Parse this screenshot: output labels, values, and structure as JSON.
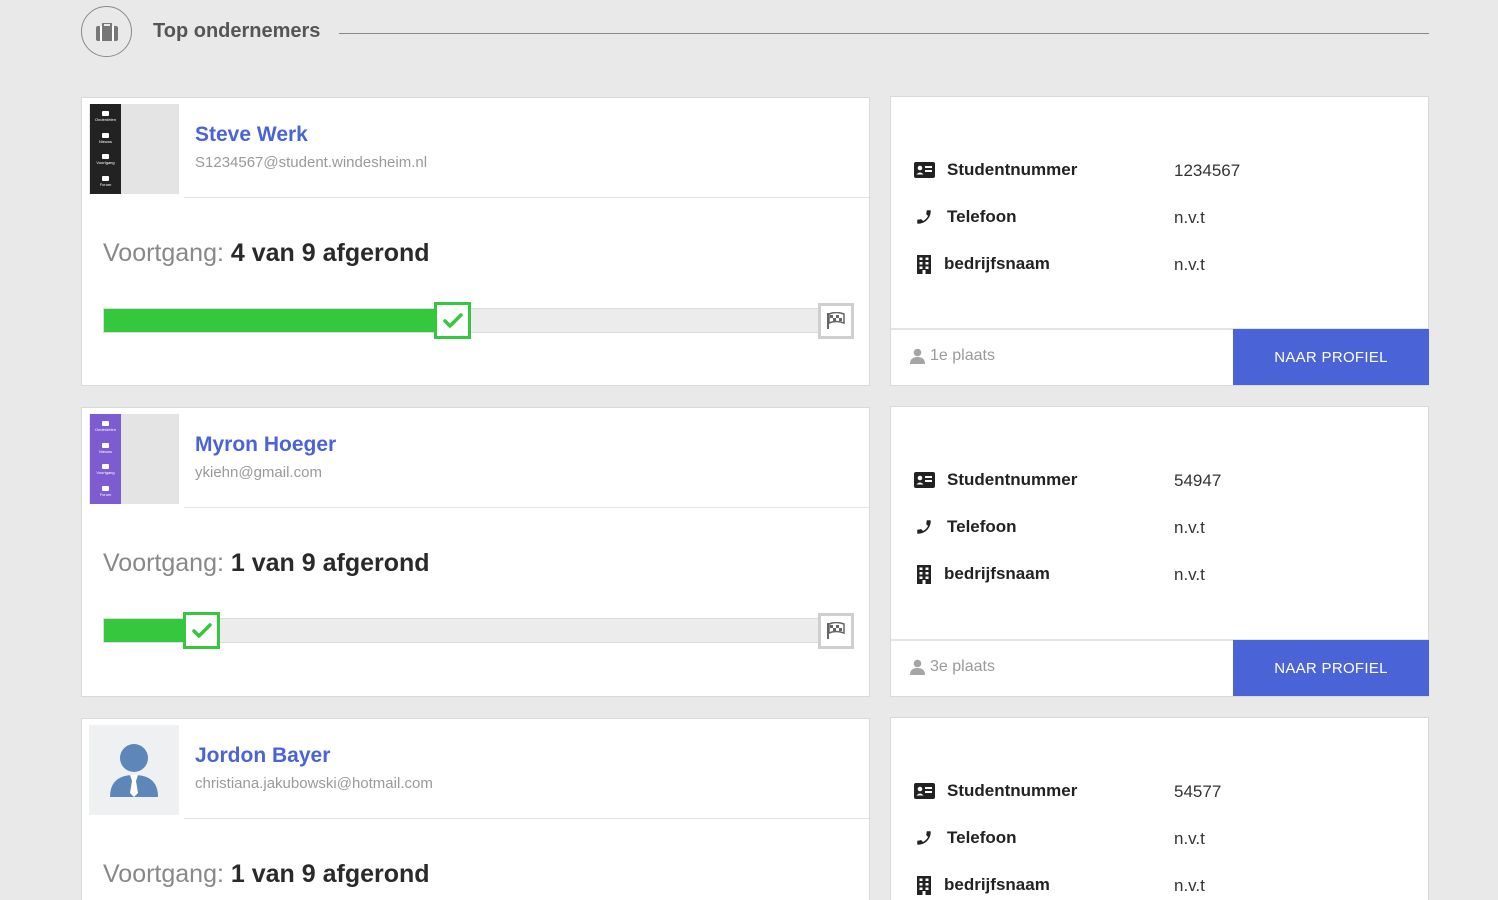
{
  "section": {
    "title": "Top ondernemers",
    "icon": "briefcase-icon"
  },
  "labels": {
    "progress_prefix": "Voortgang:",
    "studentnummer": "Studentnummer",
    "telefoon": "Telefoon",
    "bedrijfsnaam": "bedrijfsnaam",
    "profile_button": "NAAR PROFIEL"
  },
  "thumb_labels": [
    "Onderdelen",
    "Nieuws",
    "Voortgang",
    "Forum"
  ],
  "students": [
    {
      "name": "Steve Werk",
      "email": "S1234567@student.windesheim.nl",
      "progress_label": "4 van 9 afgerond",
      "completed": 4,
      "total": 9,
      "studentnummer": "1234567",
      "telefoon": "n.v.t",
      "bedrijfsnaam": "n.v.t",
      "place": "1e plaats",
      "avatar": "dark-menu-thumbnail"
    },
    {
      "name": "Myron Hoeger",
      "email": "ykiehn@gmail.com",
      "progress_label": "1 van 9 afgerond",
      "completed": 1,
      "total": 9,
      "studentnummer": "54947",
      "telefoon": "n.v.t",
      "bedrijfsnaam": "n.v.t",
      "place": "3e plaats",
      "avatar": "purple-menu-thumbnail"
    },
    {
      "name": "Jordon Bayer",
      "email": "christiana.jakubowski@hotmail.com",
      "progress_label": "1 van 9 afgerond",
      "completed": 1,
      "total": 9,
      "studentnummer": "54577",
      "telefoon": "n.v.t",
      "bedrijfsnaam": "n.v.t",
      "avatar": "person-icon"
    }
  ],
  "colors": {
    "accent": "#4a63d6",
    "progress": "#35c83f",
    "background": "#e9e9e9"
  }
}
